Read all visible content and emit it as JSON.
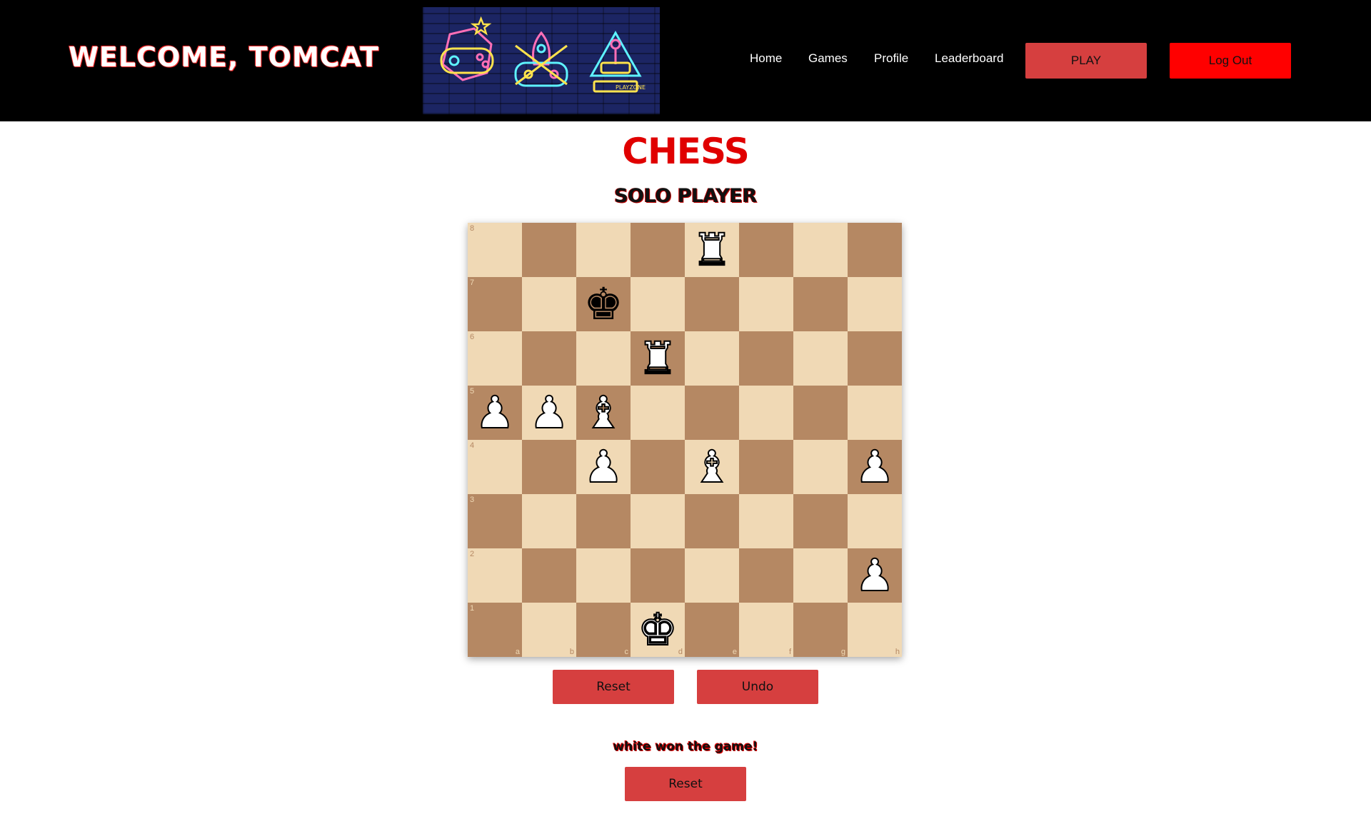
{
  "header": {
    "welcome": "WELCOME, TOMCAT",
    "banner_label": "PLAYZONE",
    "nav": [
      "Home",
      "Games",
      "Profile",
      "Leaderboard"
    ],
    "play_label": "PLAY",
    "logout_label": "Log Out",
    "colors": {
      "background": "#000000",
      "play": "#d63f3f",
      "logout": "#ff0000"
    }
  },
  "page": {
    "title": "CHESS",
    "subtitle": "SOLO PLAYER",
    "title_color": "#e00000"
  },
  "board": {
    "ranks": [
      "8",
      "7",
      "6",
      "5",
      "4",
      "3",
      "2",
      "1"
    ],
    "files": [
      "a",
      "b",
      "c",
      "d",
      "e",
      "f",
      "g",
      "h"
    ],
    "light_color": "#f0d9b5",
    "dark_color": "#b58863",
    "pieces": [
      {
        "square": "e8",
        "type": "rook",
        "color": "white"
      },
      {
        "square": "c7",
        "type": "king",
        "color": "black"
      },
      {
        "square": "d6",
        "type": "rook",
        "color": "white"
      },
      {
        "square": "a5",
        "type": "pawn",
        "color": "white"
      },
      {
        "square": "b5",
        "type": "pawn",
        "color": "white"
      },
      {
        "square": "c5",
        "type": "bishop",
        "color": "white"
      },
      {
        "square": "c4",
        "type": "pawn",
        "color": "white"
      },
      {
        "square": "e4",
        "type": "bishop",
        "color": "white"
      },
      {
        "square": "h4",
        "type": "pawn",
        "color": "white"
      },
      {
        "square": "h2",
        "type": "pawn",
        "color": "white"
      },
      {
        "square": "d1",
        "type": "king",
        "color": "white"
      }
    ]
  },
  "controls": {
    "reset_label": "Reset",
    "undo_label": "Undo",
    "status_text": "white won the game!",
    "reset2_label": "Reset"
  }
}
